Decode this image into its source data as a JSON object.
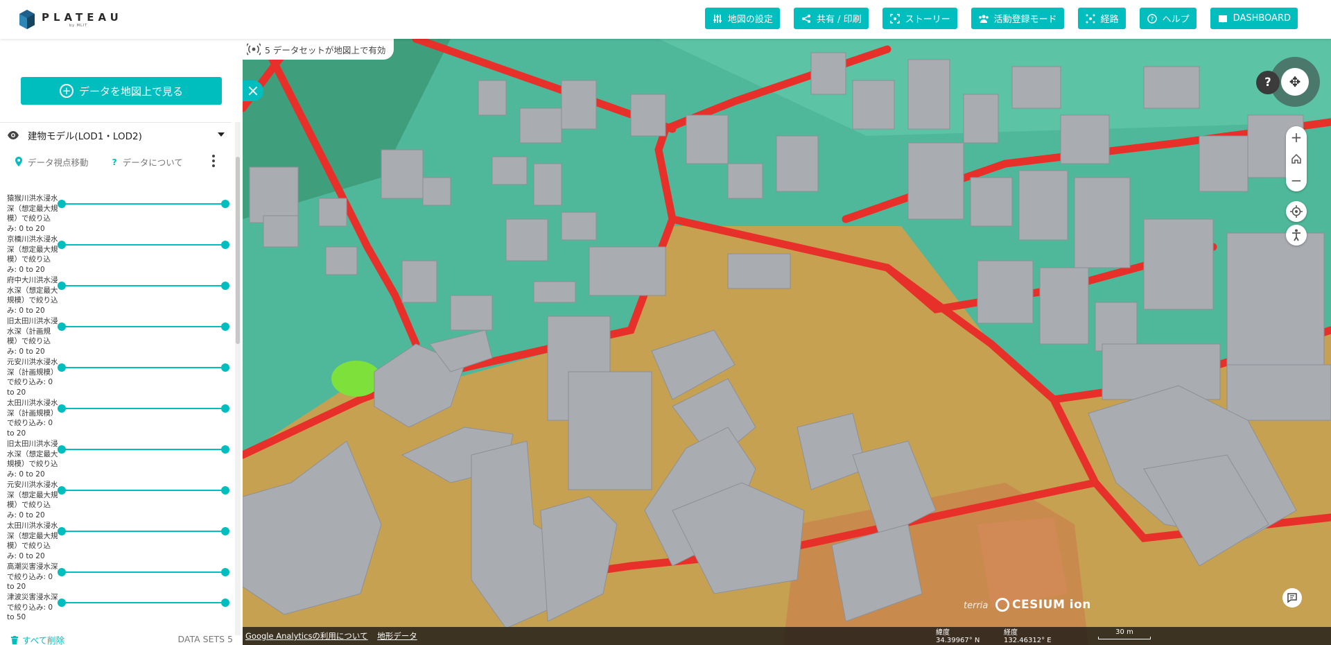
{
  "header": {
    "logo_text": "PLATEAU",
    "logo_sub": "by MLIT",
    "nav": [
      {
        "label": "地図の設定",
        "icon": "sliders-icon"
      },
      {
        "label": "共有 / 印刷",
        "icon": "share-icon"
      },
      {
        "label": "ストーリー",
        "icon": "story-icon"
      },
      {
        "label": "活動登録モード",
        "icon": "people-icon"
      },
      {
        "label": "経路",
        "icon": "route-icon"
      },
      {
        "label": "ヘルプ",
        "icon": "help-icon"
      },
      {
        "label": "DASHBOARD",
        "icon": "book-icon"
      }
    ]
  },
  "sidebar": {
    "explore_label": "データを地図上で見る",
    "dataset": {
      "title": "建物モデル(LOD1・LOD2)",
      "action_move": "データ視点移動",
      "action_about": "データについて"
    },
    "filters": [
      {
        "label": "猿猴川洪水浸水深（想定最大規模）で絞り込み: 0 to 20"
      },
      {
        "label": "京橋川洪水浸水深（想定最大規模）で絞り込み: 0 to 20"
      },
      {
        "label": "府中大川洪水浸水深（想定最大規模）で絞り込み: 0 to 20"
      },
      {
        "label": "旧太田川洪水浸水深（計画規模）で絞り込み: 0 to 20"
      },
      {
        "label": "元安川洪水浸水深（計画規模）で絞り込み: 0 to 20"
      },
      {
        "label": "太田川洪水浸水深（計画規模）で絞り込み: 0 to 20"
      },
      {
        "label": "旧太田川洪水浸水深（想定最大規模）で絞り込み: 0 to 20"
      },
      {
        "label": "元安川洪水浸水深（想定最大規模）で絞り込み: 0 to 20"
      },
      {
        "label": "太田川洪水浸水深（想定最大規模）で絞り込み: 0 to 20"
      },
      {
        "label": "高潮災害浸水深で絞り込み: 0 to 20"
      },
      {
        "label": "津波災害浸水深で絞り込み: 0 to 50"
      }
    ],
    "remove_all": "すべて削除",
    "dataset_count": "DATA SETS 5"
  },
  "map": {
    "active_datasets": "5 データセットが地図上で有効",
    "help_button": "?",
    "zoom_in": "+",
    "zoom_out": "−",
    "footer_links": [
      "Google Analyticsの利用について",
      "地形データ"
    ],
    "lat_label": "緯度",
    "lat_value": "34.39967° N",
    "lon_label": "経度",
    "lon_value": "132.46312° E",
    "scale": "30 m",
    "cesium": "CESIUM ion",
    "terria": "terria"
  },
  "colors": {
    "accent": "#00bebe",
    "flood_red": "#e8302a",
    "terrain_green": "#4fb89a",
    "terrain_tan": "#c7a152",
    "building_gray": "#a9adb2"
  }
}
